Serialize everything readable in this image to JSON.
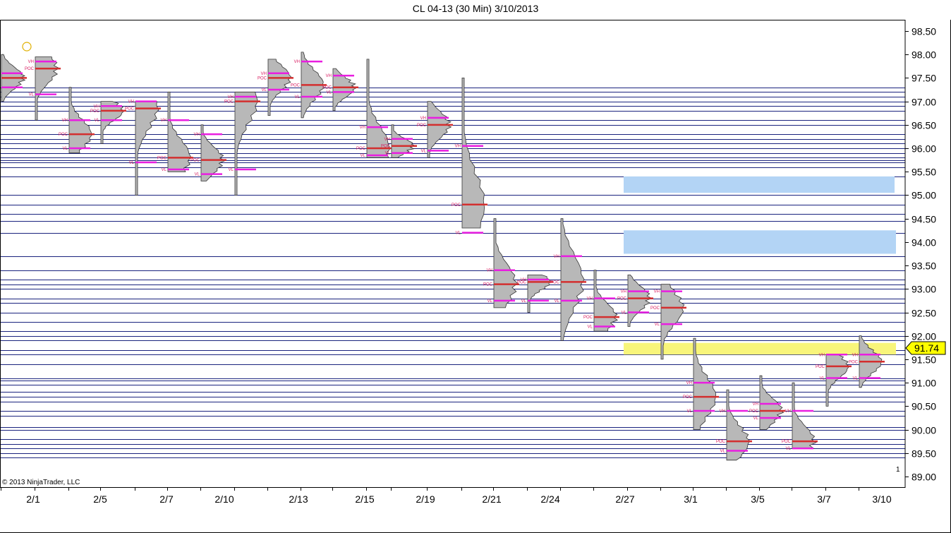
{
  "title": "CL 04-13 (30 Min)  3/10/2013",
  "copyright": "© 2013 NinjaTrader, LLC",
  "panel_number": "1",
  "current_price_label": "91.74",
  "profile_labels": {
    "high": "VH",
    "poc": "POC",
    "low": "VL"
  },
  "colors": {
    "hline": "#1a237e",
    "profile_fill": "#b8b8b8",
    "profile_edge": "#333333",
    "poc": "#d32f2f",
    "va_line": "#e91ee0",
    "va_text": "#d81b60",
    "zone_blue": "#b3d4f5",
    "zone_yellow": "#f8f57a",
    "price_marker_fill": "#ffff00",
    "frame": "#000000"
  },
  "chart_data": {
    "type": "market-profile",
    "title": "CL 04-13 (30 Min)  3/10/2013",
    "y_axis": {
      "side": "right",
      "ylim": [
        88.8,
        98.75
      ],
      "ticks": [
        "98.50",
        "98.00",
        "97.50",
        "97.00",
        "96.50",
        "96.00",
        "95.50",
        "95.00",
        "94.50",
        "94.00",
        "93.50",
        "93.00",
        "92.50",
        "92.00",
        "91.50",
        "91.00",
        "90.50",
        "90.00",
        "89.50",
        "89.00"
      ]
    },
    "x_axis": {
      "ticks": [
        "2/1",
        "2/5",
        "2/7",
        "2/10",
        "2/13",
        "2/15",
        "2/19",
        "2/21",
        "2/24",
        "2/27",
        "3/1",
        "3/5",
        "3/7",
        "3/10"
      ]
    },
    "last_price": 91.74,
    "horizontal_levels": [
      97.3,
      97.2,
      97.1,
      97.0,
      96.9,
      96.8,
      96.6,
      96.5,
      96.3,
      96.2,
      96.1,
      96.0,
      95.9,
      95.8,
      95.75,
      95.7,
      95.6,
      95.4,
      95.0,
      94.8,
      94.6,
      94.45,
      94.2,
      93.7,
      93.4,
      93.2,
      93.1,
      93.0,
      92.8,
      92.7,
      92.5,
      92.3,
      92.1,
      92.0,
      91.9,
      91.7,
      91.6,
      91.4,
      91.1,
      91.05,
      90.95,
      90.8,
      90.7,
      90.6,
      90.4,
      90.3,
      90.05,
      90.0,
      89.8,
      89.7,
      89.6,
      89.5,
      89.4
    ],
    "zones": [
      {
        "color": "blue",
        "from_date": "2/27",
        "y_low": 95.05,
        "y_high": 95.4
      },
      {
        "color": "blue",
        "from_date": "2/27",
        "y_low": 93.75,
        "y_high": 94.25
      },
      {
        "color": "yellow",
        "from_date": "2/27",
        "y_low": 91.6,
        "y_high": 91.85
      }
    ],
    "profiles": [
      {
        "high": 98.0,
        "low": 97.0,
        "poc": 97.5,
        "vah": 97.6,
        "val": 97.3
      },
      {
        "high": 97.95,
        "low": 96.6,
        "poc": 97.7,
        "vah": 97.85,
        "val": 97.15
      },
      {
        "high": 97.3,
        "low": 95.9,
        "poc": 96.3,
        "vah": 96.6,
        "val": 96.0
      },
      {
        "high": 97.0,
        "low": 96.1,
        "poc": 96.8,
        "vah": 96.9,
        "val": 96.6
      },
      {
        "high": 97.0,
        "low": 95.0,
        "poc": 96.85,
        "vah": 97.0,
        "val": 95.7
      },
      {
        "high": 97.2,
        "low": 95.5,
        "poc": 95.8,
        "vah": 96.6,
        "val": 95.55
      },
      {
        "high": 96.5,
        "low": 95.3,
        "poc": 95.75,
        "vah": 96.3,
        "val": 95.45
      },
      {
        "high": 97.2,
        "low": 95.0,
        "poc": 97.0,
        "vah": 97.1,
        "val": 95.55
      },
      {
        "high": 97.9,
        "low": 96.7,
        "poc": 97.5,
        "vah": 97.6,
        "val": 97.25
      },
      {
        "high": 98.05,
        "low": 96.65,
        "poc": 97.35,
        "vah": 97.85,
        "val": 97.1
      },
      {
        "high": 97.7,
        "low": 96.8,
        "poc": 97.3,
        "vah": 97.55,
        "val": 97.2
      },
      {
        "high": 97.9,
        "low": 95.8,
        "poc": 96.0,
        "vah": 96.45,
        "val": 95.85
      },
      {
        "high": 96.5,
        "low": 95.8,
        "poc": 96.05,
        "vah": 96.2,
        "val": 95.9
      },
      {
        "high": 97.0,
        "low": 95.8,
        "poc": 96.5,
        "vah": 96.65,
        "val": 95.95
      },
      {
        "high": 97.5,
        "low": 94.3,
        "poc": 94.8,
        "vah": 96.05,
        "val": 94.2
      },
      {
        "high": 94.5,
        "low": 92.6,
        "poc": 93.1,
        "vah": 93.4,
        "val": 92.75
      },
      {
        "high": 93.3,
        "low": 92.5,
        "poc": 93.15,
        "vah": 93.2,
        "val": 92.75
      },
      {
        "high": 94.5,
        "low": 91.9,
        "poc": 93.15,
        "vah": 93.7,
        "val": 92.75
      },
      {
        "high": 93.4,
        "low": 92.1,
        "poc": 92.4,
        "vah": 92.8,
        "val": 92.2
      },
      {
        "high": 93.3,
        "low": 92.2,
        "poc": 92.8,
        "vah": 92.95,
        "val": 92.5
      },
      {
        "high": 93.1,
        "low": 91.5,
        "poc": 92.6,
        "vah": 92.95,
        "val": 92.25
      },
      {
        "high": 91.95,
        "low": 90.0,
        "poc": 90.7,
        "vah": 91.0,
        "val": 90.4
      },
      {
        "high": 90.85,
        "low": 89.35,
        "poc": 89.75,
        "vah": 90.4,
        "val": 89.55
      },
      {
        "high": 91.15,
        "low": 90.0,
        "poc": 90.4,
        "vah": 90.55,
        "val": 90.25
      },
      {
        "high": 91.0,
        "low": 89.6,
        "poc": 89.75,
        "vah": 90.4,
        "val": 89.6
      },
      {
        "high": 91.6,
        "low": 90.5,
        "poc": 91.35,
        "vah": 91.6,
        "val": 91.1
      },
      {
        "high": 92.0,
        "low": 90.9,
        "poc": 91.45,
        "vah": 91.6,
        "val": 91.1
      }
    ]
  }
}
